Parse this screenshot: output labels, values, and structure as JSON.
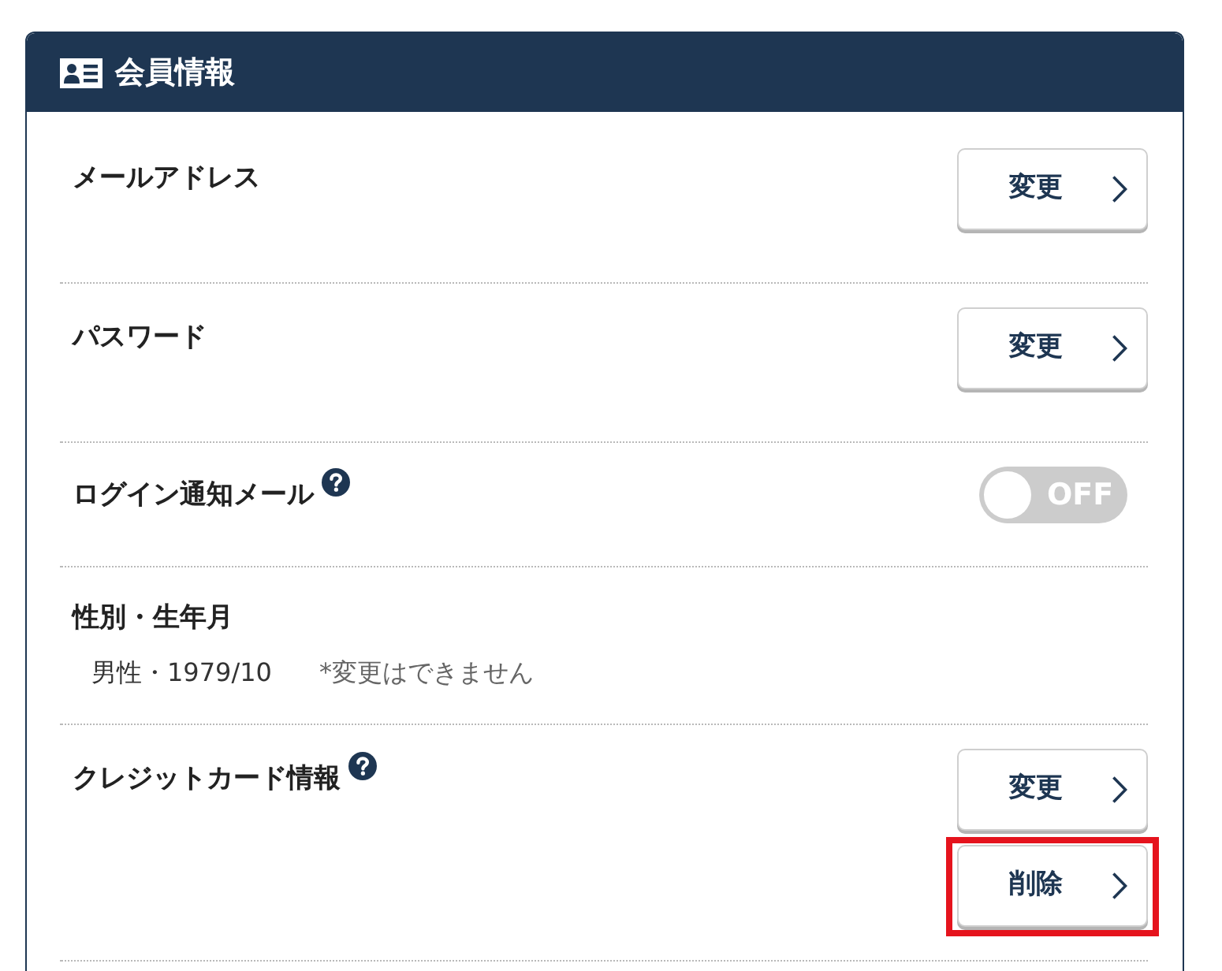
{
  "panel": {
    "title": "会員情報"
  },
  "rows": [
    {
      "kind": "action",
      "label": "メールアドレス",
      "help": false,
      "buttons": [
        {
          "label": "変更",
          "highlighted": false
        }
      ]
    },
    {
      "kind": "action",
      "label": "パスワード",
      "help": false,
      "buttons": [
        {
          "label": "変更",
          "highlighted": false
        }
      ]
    },
    {
      "kind": "toggle",
      "label": "ログイン通知メール",
      "help": true,
      "toggle": {
        "on": false,
        "text": "OFF"
      }
    },
    {
      "kind": "info",
      "label": "性別・生年月",
      "value": "男性・1979/10",
      "note": "*変更はできません"
    },
    {
      "kind": "action",
      "label": "クレジットカード情報",
      "help": true,
      "buttons": [
        {
          "label": "変更",
          "highlighted": false
        },
        {
          "label": "削除",
          "highlighted": true
        }
      ]
    }
  ]
}
